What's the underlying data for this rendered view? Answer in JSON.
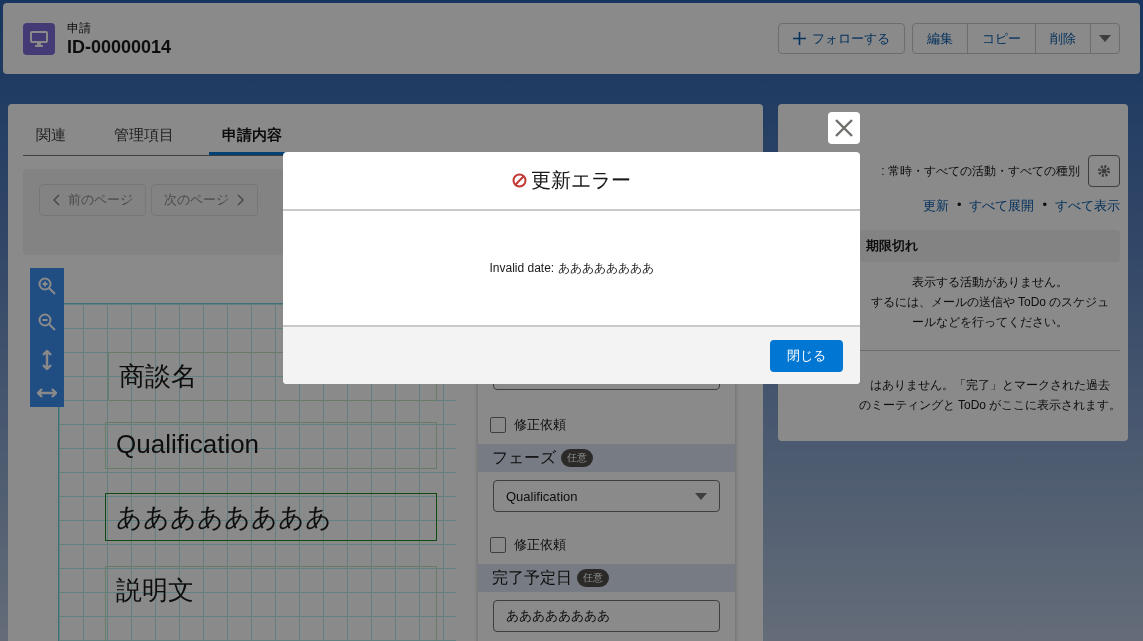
{
  "record": {
    "object_label": "申請",
    "title": "ID-00000014",
    "actions": [
      {
        "label": "フォローする",
        "kind": "follow"
      },
      {
        "label": "編集",
        "kind": "group"
      },
      {
        "label": "コピー",
        "kind": "group"
      },
      {
        "label": "削除",
        "kind": "group"
      }
    ]
  },
  "tabs": [
    {
      "label": "関連",
      "selected": false
    },
    {
      "label": "管理項目",
      "selected": false
    },
    {
      "label": "申請内容",
      "selected": true
    }
  ],
  "pager": {
    "buttons": [
      {
        "label": "前のページ",
        "kind": "prev",
        "disabled": true
      },
      {
        "label": "次のページ",
        "kind": "next",
        "disabled": true
      }
    ]
  },
  "canvas": {
    "boxes": [
      {
        "text": "商談名",
        "selected": false
      },
      {
        "text": "Qualification",
        "selected": false
      },
      {
        "text": "ああああああああ",
        "selected": true
      },
      {
        "text": "説明文",
        "selected": false
      }
    ]
  },
  "form": {
    "items": [
      {
        "kind": "input"
      },
      {
        "kind": "checkbox",
        "label": "修正依頼",
        "checked": false
      },
      {
        "kind": "section",
        "label": "フェーズ",
        "badge": "任意"
      },
      {
        "kind": "select",
        "value": "Qualification"
      },
      {
        "kind": "checkbox",
        "label": "修正依頼",
        "checked": false
      },
      {
        "kind": "section",
        "label": "完了予定日",
        "badge": "任意"
      },
      {
        "kind": "input",
        "value": "ああああああああ"
      }
    ]
  },
  "activity": {
    "filter": ": 常時・すべての活動・すべての種別",
    "links": [
      "更新",
      "すべて展開",
      "すべて表示"
    ],
    "separator": "•",
    "section_title": "期限切れ",
    "empty_lines": [
      "表示する活動がありません。",
      "するには、メールの送信や ToDo のスケジュ",
      "ールなどを行ってください。"
    ],
    "past_lines": [
      "はありません。「完了」とマークされた過去",
      "のミーティングと ToDo がここに表示されます。"
    ]
  },
  "modal": {
    "title": "更新エラー",
    "message": "Invalid date: ああああああああ",
    "close_button": "閉じる"
  }
}
